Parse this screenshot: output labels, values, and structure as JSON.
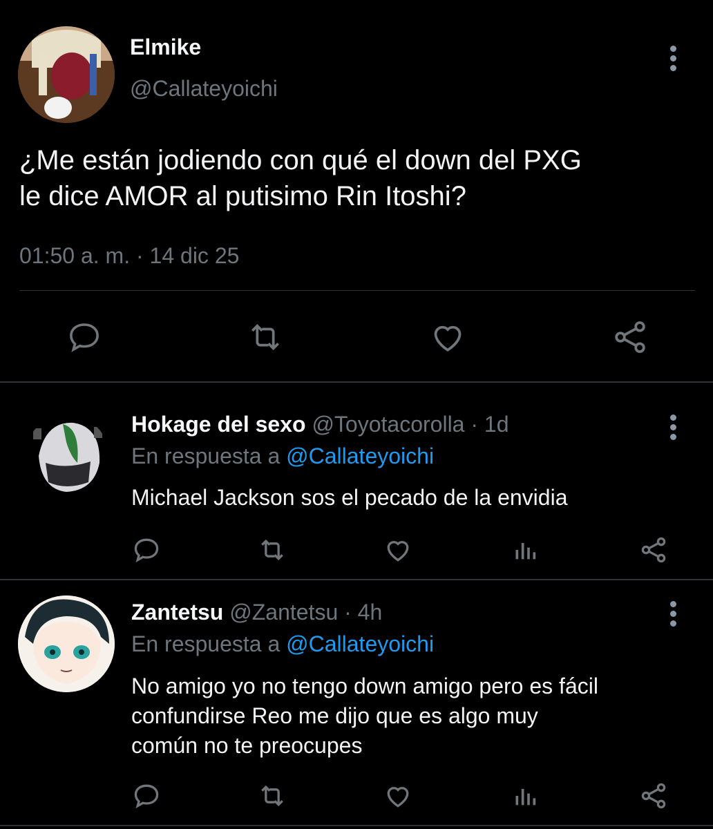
{
  "main_tweet": {
    "name": "Elmike",
    "handle": "@Callateyoichi",
    "text_line1": "¿Me están jodiendo con qué el down del PXG",
    "text_line2": "le dice AMOR al putisimo Rin Itoshi?",
    "time": "01:50 a. m.",
    "separator": "·",
    "date": "14 dic 25",
    "actions": [
      "reply-icon",
      "retweet-icon",
      "like-icon",
      "share-icon"
    ]
  },
  "replies": [
    {
      "name": "Hokage del sexo",
      "handle": "@Toyotacorolla",
      "separator": "·",
      "time": "1d",
      "reply_prefix": "En respuesta a",
      "reply_to": "@Callateyoichi",
      "text_lines": [
        "Michael Jackson sos el pecado de la envidia"
      ],
      "actions": [
        "reply-icon",
        "retweet-icon",
        "like-icon",
        "views-icon",
        "share-icon"
      ]
    },
    {
      "name": "Zantetsu",
      "handle": "@Zantetsu",
      "separator": "·",
      "time": "4h",
      "reply_prefix": "En respuesta a",
      "reply_to": "@Callateyoichi",
      "text_lines": [
        "No amigo yo no tengo down amigo pero es fácil",
        "confundirse Reo me dijo que es algo muy",
        "común no te preocupes"
      ],
      "actions": [
        "reply-icon",
        "retweet-icon",
        "like-icon",
        "views-icon",
        "share-icon"
      ]
    }
  ],
  "colors": {
    "background": "#000000",
    "text": "#e7e9ea",
    "muted": "#6e767d",
    "link": "#1d9bf0",
    "divider": "#2f3336"
  }
}
